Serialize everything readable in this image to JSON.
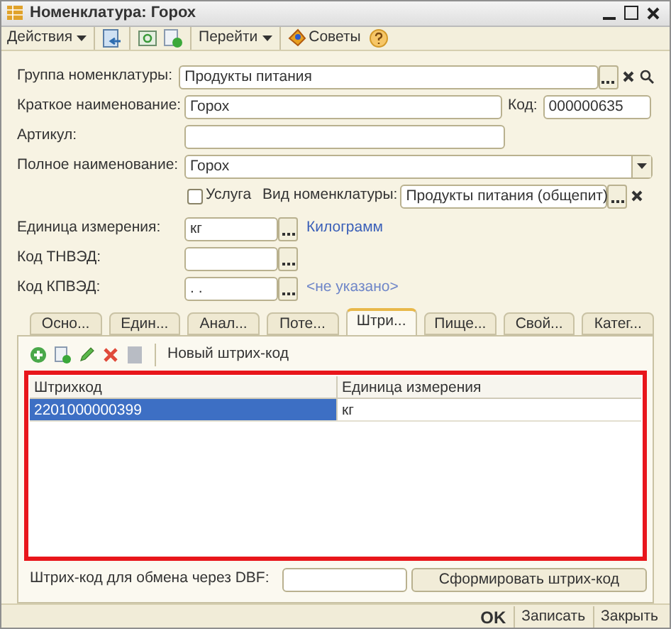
{
  "window": {
    "title": "Номенклатура: Горох"
  },
  "toolbar": {
    "actions_menu": "Действия",
    "goto_menu": "Перейти",
    "tips_button": "Советы"
  },
  "form": {
    "group": {
      "label": "Группа номенклатуры:",
      "value": "Продукты питания"
    },
    "short_name": {
      "label": "Краткое наименование:",
      "value": "Горох"
    },
    "code": {
      "label": "Код:",
      "value": "000000635"
    },
    "article": {
      "label": "Артикул:"
    },
    "full_name": {
      "label": "Полное наименование:",
      "value": "Горох"
    },
    "service": {
      "label": "Услуга",
      "checked": false
    },
    "item_type": {
      "label": "Вид номенклатуры:",
      "value": "Продукты питания (общепит)"
    },
    "unit": {
      "label": "Единица измерения:",
      "value": "кг",
      "link": "Килограмм"
    },
    "tnved": {
      "label": "Код ТНВЭД:"
    },
    "kpved": {
      "label": "Код КПВЭД:",
      "value": ". .",
      "link": "<не указано>"
    }
  },
  "tabs": [
    {
      "label": "Осно...",
      "selected": false
    },
    {
      "label": "Един...",
      "selected": false
    },
    {
      "label": "Анал...",
      "selected": false
    },
    {
      "label": "Поте...",
      "selected": false
    },
    {
      "label": "Штри...",
      "selected": true
    },
    {
      "label": "Пище...",
      "selected": false
    },
    {
      "label": "Свой...",
      "selected": false
    },
    {
      "label": "Катег...",
      "selected": false
    }
  ],
  "barcodes": {
    "new_button": "Новый штрих-код",
    "columns": [
      "Штрихкод",
      "Единица измерения"
    ],
    "rows": [
      {
        "barcode": "2201000000399",
        "unit": "кг",
        "selected": true
      }
    ],
    "dbf": {
      "label": "Штрих-код для обмена через DBF:",
      "button": "Сформировать штрих-код"
    }
  },
  "footer": [
    {
      "label": "OK",
      "kind": "default"
    },
    {
      "label": "Записать",
      "kind": "normal"
    },
    {
      "label": "Закрыть",
      "kind": "normal"
    }
  ]
}
